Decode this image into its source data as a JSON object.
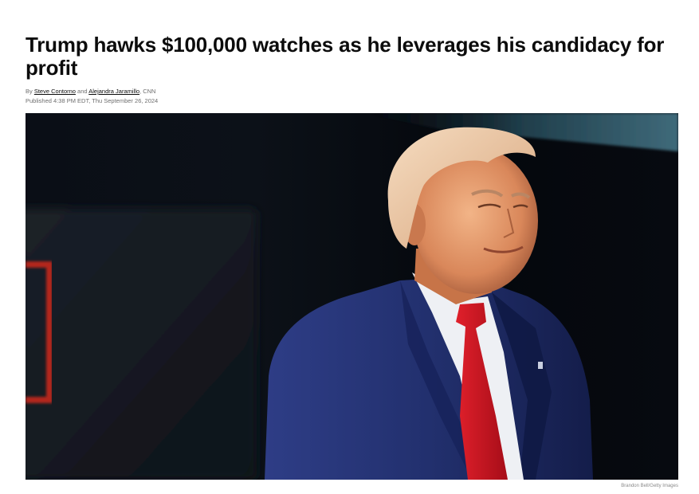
{
  "article": {
    "headline": "Trump hawks $100,000 watches as he leverages his candidacy for profit",
    "byline": {
      "by": "By ",
      "author1": "Steve Contorno",
      "and": " and ",
      "author2": "Alejandra Jaramillo",
      "outlet": ", CNN"
    },
    "published": "Published 4:38 PM EDT, Thu September 26, 2024",
    "image_credit": "Brandon Bell/Getty Images"
  },
  "colors": {
    "headline": "#0c0c0c",
    "meta": "#6e6e6e",
    "suit": "#1f2c6b",
    "tie": "#d0121f",
    "backdrop": "#05080f",
    "accent_red": "#b3261e",
    "accent_teal": "#3f6a7a"
  }
}
